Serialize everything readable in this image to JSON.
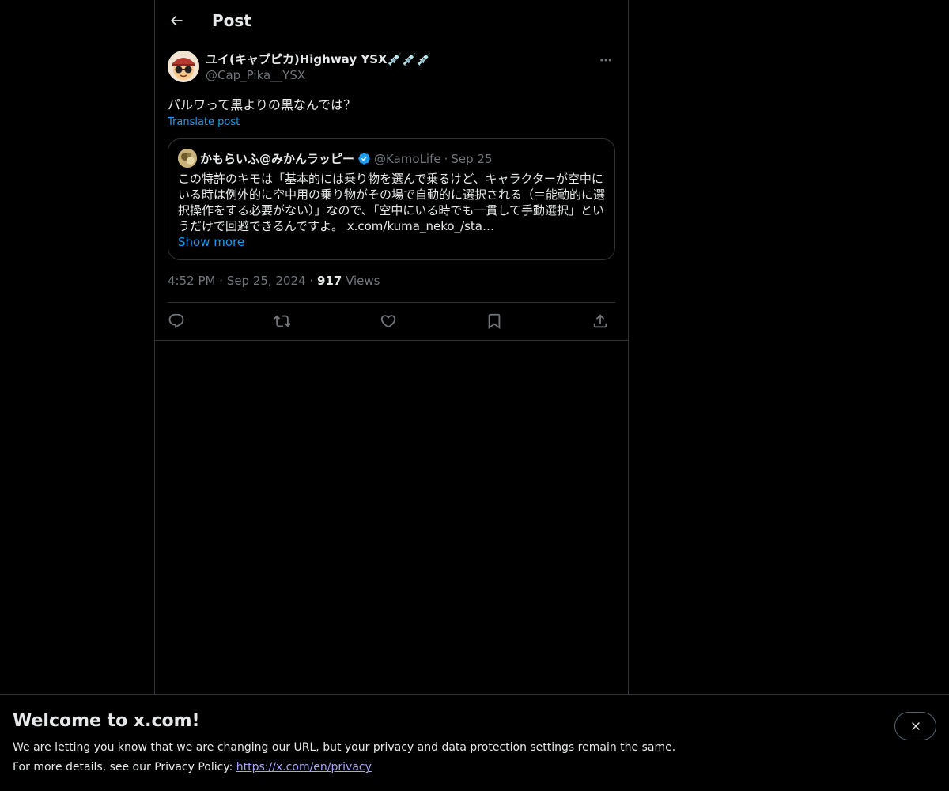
{
  "header": {
    "title": "Post",
    "back_icon": "arrow-left-icon"
  },
  "post": {
    "author_name": "ユイ(キャプピカ)Highway YSX💉💉💉",
    "author_handle": "@Cap_Pika__YSX",
    "text": "パルワって黒よりの黒なんでは？",
    "translate_label": "Translate post",
    "time": "4:52 PM",
    "date": "Sep 25, 2024",
    "views_count": "917",
    "views_label": "Views",
    "separator": "·"
  },
  "quote": {
    "name": "かもらいふ@みかんラッピー",
    "handle": "@KamoLife",
    "separator": "·",
    "date": "Sep 25",
    "text": "この特許のキモは「基本的には乗り物を選んで乗るけど、キャラクターが空中にいる時は例外的に空中用の乗り物がその場で自動的に選択される（＝能動的に選択操作をする必要がない）」なので、「空中にいる時でも一貫して手動選択」というだけで回避できるんですよ。 x.com/kuma_neko_/sta…",
    "show_more": "Show more"
  },
  "actions": [
    "reply-icon",
    "repost-icon",
    "like-icon",
    "bookmark-icon",
    "share-icon"
  ],
  "banner": {
    "title": "Welcome to x.com!",
    "line1": "We are letting you know that we are changing our URL, but your privacy and data protection settings remain the same.",
    "line2_prefix": "For more details, see our Privacy Policy: ",
    "link": "https://x.com/en/privacy"
  },
  "colors": {
    "accent": "#1d9bf0",
    "text": "#e7e9ea",
    "muted": "#71767b",
    "border": "#2f3336",
    "link_purple": "#a9a4f7"
  }
}
